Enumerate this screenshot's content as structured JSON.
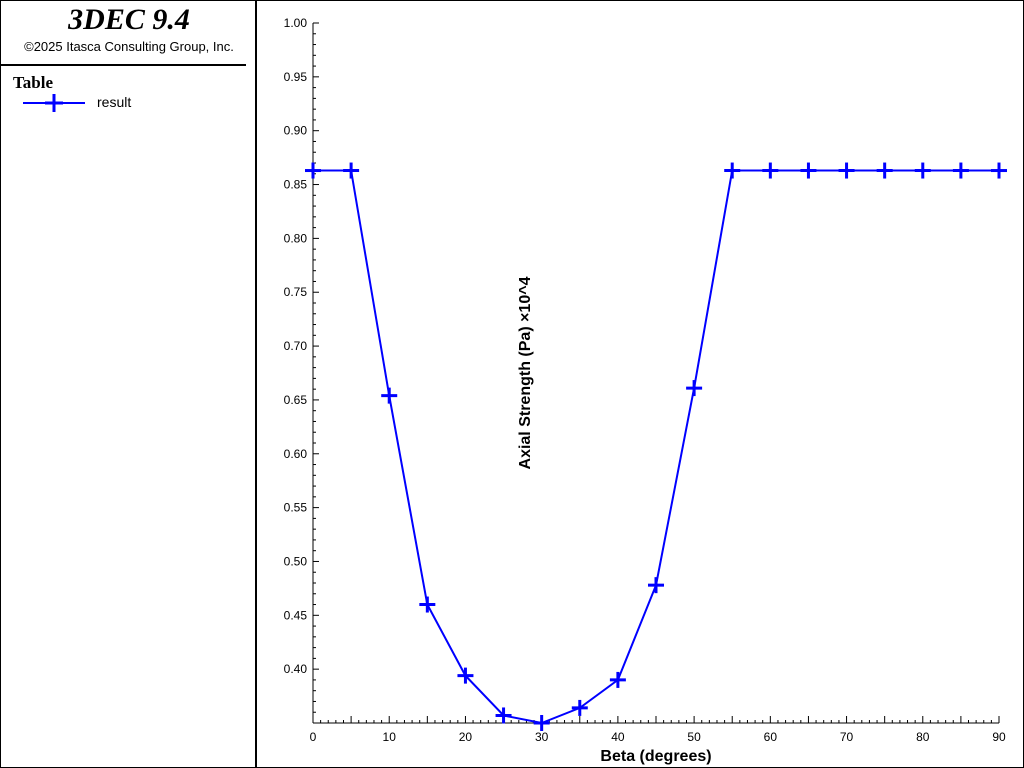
{
  "app": {
    "title": "3DEC 9.4",
    "copyright": "©2025 Itasca Consulting Group, Inc."
  },
  "legend": {
    "title": "Table",
    "entries": [
      {
        "label": "result",
        "color": "#0000ff",
        "marker": "plus"
      }
    ]
  },
  "chart_data": {
    "type": "line",
    "xlabel": "Beta (degrees)",
    "ylabel": "Axial Strength (Pa) ×10^4",
    "xlim": [
      0,
      90
    ],
    "ylim": [
      0.35,
      1.0
    ],
    "x_ticks": [
      "0",
      "10",
      "20",
      "30",
      "40",
      "50",
      "60",
      "70",
      "80",
      "90"
    ],
    "y_ticks": [
      "0.40",
      "0.45",
      "0.50",
      "0.55",
      "0.60",
      "0.65",
      "0.70",
      "0.75",
      "0.80",
      "0.85",
      "0.90",
      "0.95",
      "1.00"
    ],
    "grid": false,
    "series": [
      {
        "name": "result",
        "color": "#0000ff",
        "marker": "plus",
        "x": [
          0,
          5,
          10,
          15,
          20,
          25,
          30,
          35,
          40,
          45,
          50,
          55,
          60,
          65,
          70,
          75,
          80,
          85,
          90
        ],
        "y": [
          0.863,
          0.863,
          0.654,
          0.46,
          0.394,
          0.357,
          0.35,
          0.364,
          0.39,
          0.478,
          0.661,
          0.863,
          0.863,
          0.863,
          0.863,
          0.863,
          0.863,
          0.863,
          0.863
        ]
      }
    ]
  }
}
